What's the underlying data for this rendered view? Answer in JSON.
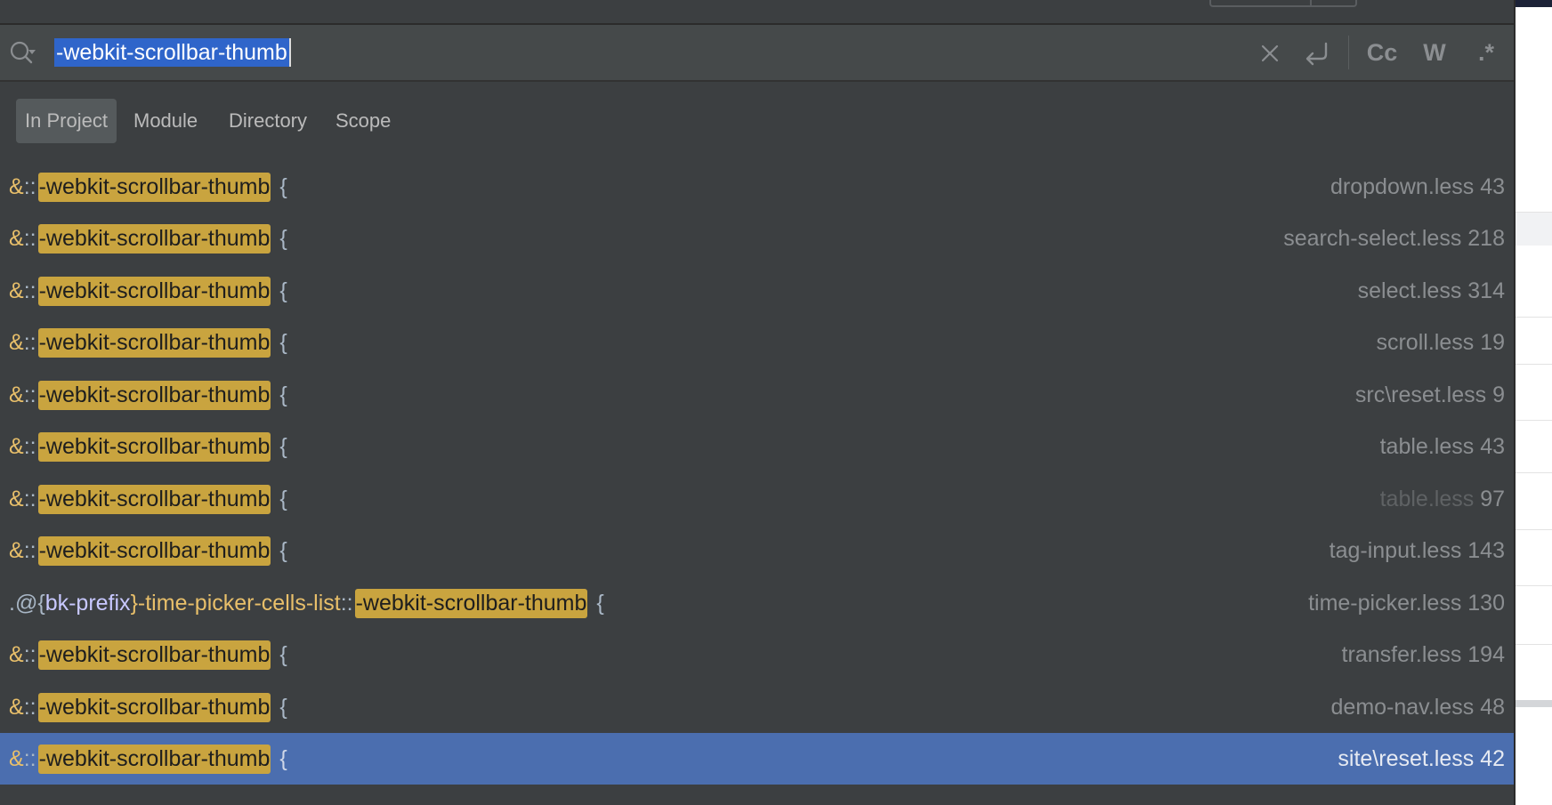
{
  "search": {
    "query": "-webkit-scrollbar-thumb",
    "tools": {
      "match_case_label": "Cc",
      "words_label": "W",
      "regex_label": ".*"
    }
  },
  "scope_tabs": [
    {
      "label": "In Project",
      "active": true
    },
    {
      "label": "Module",
      "active": false
    },
    {
      "label": "Directory",
      "active": false
    },
    {
      "label": "Scope",
      "active": false
    }
  ],
  "results": [
    {
      "pre_a": "&",
      "pre_b": "::",
      "match": "-webkit-scrollbar-thumb",
      "post": "{",
      "file": "dropdown.less",
      "line": "43"
    },
    {
      "pre_a": "&",
      "pre_b": "::",
      "match": "-webkit-scrollbar-thumb",
      "post": "{",
      "file": "search-select.less",
      "line": "218"
    },
    {
      "pre_a": "&",
      "pre_b": "::",
      "match": "-webkit-scrollbar-thumb",
      "post": "{",
      "file": "select.less",
      "line": "314"
    },
    {
      "pre_a": "&",
      "pre_b": "::",
      "match": "-webkit-scrollbar-thumb",
      "post": "{",
      "file": "scroll.less",
      "line": "19"
    },
    {
      "pre_a": "&",
      "pre_b": "::",
      "match": "-webkit-scrollbar-thumb",
      "post": "{",
      "file": "src\\reset.less",
      "line": "9"
    },
    {
      "pre_a": "&",
      "pre_b": "::",
      "match": "-webkit-scrollbar-thumb",
      "post": "{",
      "file": "table.less",
      "line": "43"
    },
    {
      "pre_a": "&",
      "pre_b": "::",
      "match": "-webkit-scrollbar-thumb",
      "post": "{",
      "file": "table.less",
      "line": "97"
    },
    {
      "pre_a": "&",
      "pre_b": "::",
      "match": "-webkit-scrollbar-thumb",
      "post": "{",
      "file": "tag-input.less",
      "line": "143"
    },
    {
      "pre_a": ".@{",
      "pre_var": "bk-prefix",
      "pre_c": "}-time-picker-cells-list",
      "pre_b": "::",
      "match": "-webkit-scrollbar-thumb",
      "post": "{",
      "file": "time-picker.less",
      "line": "130"
    },
    {
      "pre_a": "&",
      "pre_b": "::",
      "match": "-webkit-scrollbar-thumb",
      "post": "{",
      "file": "transfer.less",
      "line": "194"
    },
    {
      "pre_a": "&",
      "pre_b": "::",
      "match": "-webkit-scrollbar-thumb",
      "post": "{",
      "file": "demo-nav.less",
      "line": "48"
    },
    {
      "pre_a": "&",
      "pre_b": "::",
      "match": "-webkit-scrollbar-thumb",
      "post": "{",
      "file": "site\\reset.less",
      "line": "42"
    }
  ],
  "colors": {
    "background": "#3c3f41",
    "match_highlight": "#c9a43f",
    "selection": "#4b6eaf",
    "query_selection": "#2f65ca"
  }
}
